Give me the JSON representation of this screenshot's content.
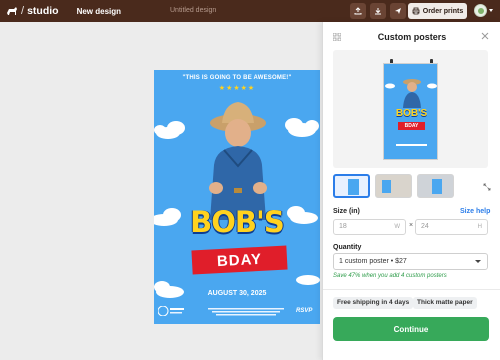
{
  "app": {
    "brand": "studio"
  },
  "toolbar": {
    "new_design_label": "New design",
    "doc_title": "Untitled design",
    "order_label": "Order prints"
  },
  "poster": {
    "quote": "\"THIS IS GOING TO BE AWESOME!\"",
    "stars": "★★★★★",
    "headline": "BOB'S",
    "subheadline": "BDAY",
    "date": "AUGUST 30, 2025",
    "rsvp": "RSVP"
  },
  "panel": {
    "title": "Custom posters",
    "size_label": "Size (in)",
    "size_help": "Size help",
    "width_value": "18",
    "width_unit": "W",
    "height_value": "24",
    "height_unit": "H",
    "dim_separator": "×",
    "quantity_label": "Quantity",
    "quantity_value": "1 custom poster • $27",
    "save_note": "Save 47% when you add 4 custom posters",
    "chips": [
      "Free shipping in 4 days",
      "Thick matte paper"
    ],
    "continue_label": "Continue"
  },
  "colors": {
    "topbar": "#4a2a1c",
    "poster_bg": "#4aa7f0",
    "accent_blue": "#2b7de9",
    "continue_green": "#37a95a"
  }
}
